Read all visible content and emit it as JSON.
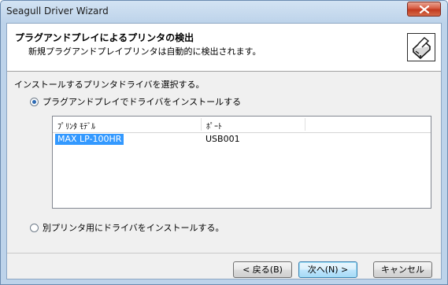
{
  "window": {
    "title": "Seagull Driver Wizard"
  },
  "header": {
    "title": "プラグアンドプレイによるプリンタの検出",
    "subtitle": "新規プラグアンドプレイプリンタは自動的に検出されます。",
    "icon": "printer-icon"
  },
  "body": {
    "prompt": "インストールするプリンタドライバを選択する。",
    "option_pnp": {
      "label": "プラグアンドプレイでドライバをインストールする",
      "checked": true
    },
    "option_other": {
      "label": "別プリンタ用にドライバをインストールする。",
      "checked": false
    },
    "printer_list": {
      "columns": [
        "ﾌﾟﾘﾝﾀ ﾓﾃﾞﾙ",
        "ﾎﾟｰﾄ"
      ],
      "rows": [
        {
          "model": "MAX LP-100HR",
          "port": "USB001",
          "selected": true
        }
      ]
    }
  },
  "buttons": {
    "back": "< 戻る(B)",
    "next": "次へ(N) >",
    "cancel": "キャンセル"
  },
  "colors": {
    "selection": "#3399ff",
    "close_button": "#c23a1f"
  }
}
